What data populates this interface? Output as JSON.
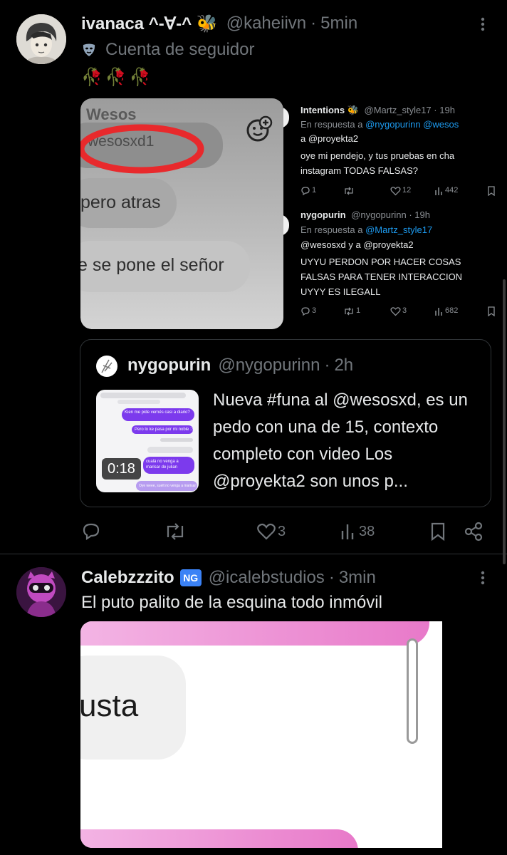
{
  "tweet1": {
    "display_name": "ivanaca ^-∀-^ 🐝",
    "handle": "@kaheiivn",
    "time": "5min",
    "separator": "·",
    "follower_badge_text": "Cuenta de seguidor",
    "emoji_line": "🥀🥀🥀",
    "media": {
      "left_image": {
        "partial_name": "Wesos",
        "circled_text": "wesosxd1",
        "line1": "pero atras",
        "line2": "e se pone el señor"
      },
      "reply1": {
        "name": "Intentions 🐝",
        "handle": "@Martz_style17",
        "time": "19h",
        "replying_prefix": "En respuesta a",
        "replying_to_a": "@nygopurinn @wesos",
        "replying_to_b": "a @proyekta2",
        "text_line1": "oye mi pendejo, y tus pruebas en cha",
        "text_line2": "instagram TODAS FALSAS?",
        "reply_count": "1",
        "like_count": "12",
        "view_count": "442"
      },
      "reply2": {
        "name": "nygopurin",
        "handle": "@nygopurinn",
        "time": "19h",
        "replying_prefix": "En respuesta a",
        "replying_to_a": "@Martz_style17",
        "replying_to_b": "@wesosxd y a @proyekta2",
        "text_line1": "UYYU PERDON POR HACER COSAS",
        "text_line2": "FALSAS PARA TENER INTERACCION",
        "text_line3": "UYYY ES ILEGALL",
        "reply_count": "3",
        "retweet_count": "1",
        "like_count": "3",
        "view_count": "682"
      }
    },
    "quote": {
      "name": "nygopurin",
      "handle": "@nygopurinn",
      "time": "2h",
      "video_duration": "0:18",
      "text": "Nueva #funa al @wesosxd, es un pedo con una de 15, contexto completo con video Los @proyekta2 son unos p...",
      "chat_bubbles": [
        "Kien me pide vernés casi a diario?",
        "Pero lo ke pasa por mi noble :3",
        "cualá no venga a marisar de julian",
        "Oye weee, suelt no venga a marisar vi"
      ]
    },
    "actions": {
      "likes": "3",
      "views": "38"
    }
  },
  "tweet2": {
    "display_name": "Calebzzzito",
    "ng_badge": "NG",
    "handle": "@icalebstudios",
    "time": "3min",
    "separator": "·",
    "text": "El puto palito de la esquina todo inmóvil",
    "media_text": "usta"
  },
  "colors": {
    "background": "#000000",
    "text": "#e7e9ea",
    "muted": "#71767b",
    "link": "#1d9bf0",
    "divider": "#2f3336",
    "accent_purple": "#7c3aed",
    "pink": "#e879c9"
  }
}
